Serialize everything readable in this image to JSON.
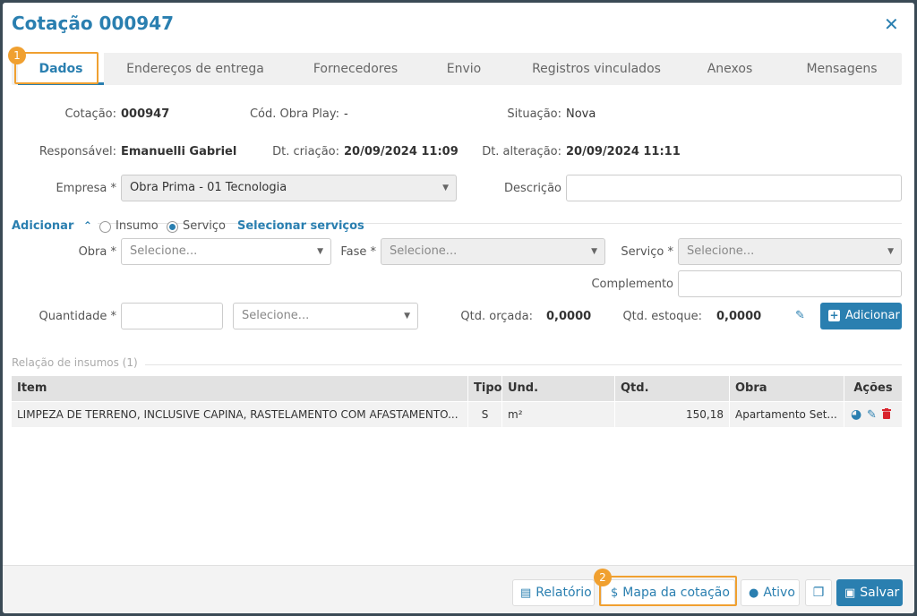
{
  "header": {
    "title": "Cotação 000947",
    "close_glyph": "✕"
  },
  "tabs": [
    "Dados",
    "Endereços de entrega",
    "Fornecedores",
    "Envio",
    "Registros vinculados",
    "Anexos",
    "Mensagens"
  ],
  "annotations": {
    "badge1": "1",
    "badge2": "2"
  },
  "info": {
    "cotacao_label": "Cotação:",
    "cotacao_value": "000947",
    "obra_play_label": "Cód. Obra Play:",
    "obra_play_value": "-",
    "situacao_label": "Situação:",
    "situacao_value": "Nova",
    "responsavel_label": "Responsável:",
    "responsavel_value": "Emanuelli Gabriel",
    "dt_criacao_label": "Dt. criação:",
    "dt_criacao_value": "20/09/2024 11:09",
    "dt_alteracao_label": "Dt. alteração:",
    "dt_alteracao_value": "20/09/2024 11:11",
    "empresa_label": "Empresa *",
    "empresa_value": "Obra Prima - 01 Tecnologia",
    "descricao_label": "Descrição"
  },
  "adicionar": {
    "toggle_label": "Adicionar",
    "chevron_glyph": "⌃",
    "insumo_label": "Insumo",
    "servico_label": "Serviço",
    "selecionar_link": "Selecionar serviços",
    "obra_label": "Obra *",
    "obra_placeholder": "Selecione...",
    "fase_label": "Fase *",
    "fase_placeholder": "Selecione...",
    "servico_field_label": "Serviço *",
    "servico_placeholder": "Selecione...",
    "complemento_label": "Complemento",
    "quantidade_label": "Quantidade *",
    "unidade_placeholder": "Selecione...",
    "qtd_orcada_label": "Qtd. orçada:",
    "qtd_orcada_value": "0,0000",
    "qtd_estoque_label": "Qtd. estoque:",
    "qtd_estoque_value": "0,0000",
    "add_button": "Adicionar",
    "add_button_glyph": "+",
    "eraser_glyph": "✎"
  },
  "relacao": {
    "title": "Relação de insumos (1)",
    "columns": [
      "Item",
      "Tipo",
      "Und.",
      "Qtd.",
      "Obra",
      "Ações"
    ],
    "rows": [
      {
        "item": "LIMPEZA DE TERRENO, INCLUSIVE CAPINA, RASTELAMENTO COM AFASTAMENTO...",
        "tipo": "S",
        "und": "m²",
        "qtd": "150,18",
        "obra": "Apartamento Set...",
        "action_glyphs": {
          "chart": "◕",
          "edit": "✎"
        }
      }
    ]
  },
  "footer": {
    "relatorio": "Relatório",
    "relatorio_glyph": "▤",
    "mapa": "Mapa da cotação",
    "mapa_glyph": "$",
    "ativo": "Ativo",
    "ativo_glyph": "●",
    "copy_glyph": "❐",
    "salvar": "Salvar",
    "salvar_glyph": "▣"
  },
  "colors": {
    "accent": "#2a7fb0",
    "highlight": "#f0a030",
    "delete": "#d9232d"
  }
}
